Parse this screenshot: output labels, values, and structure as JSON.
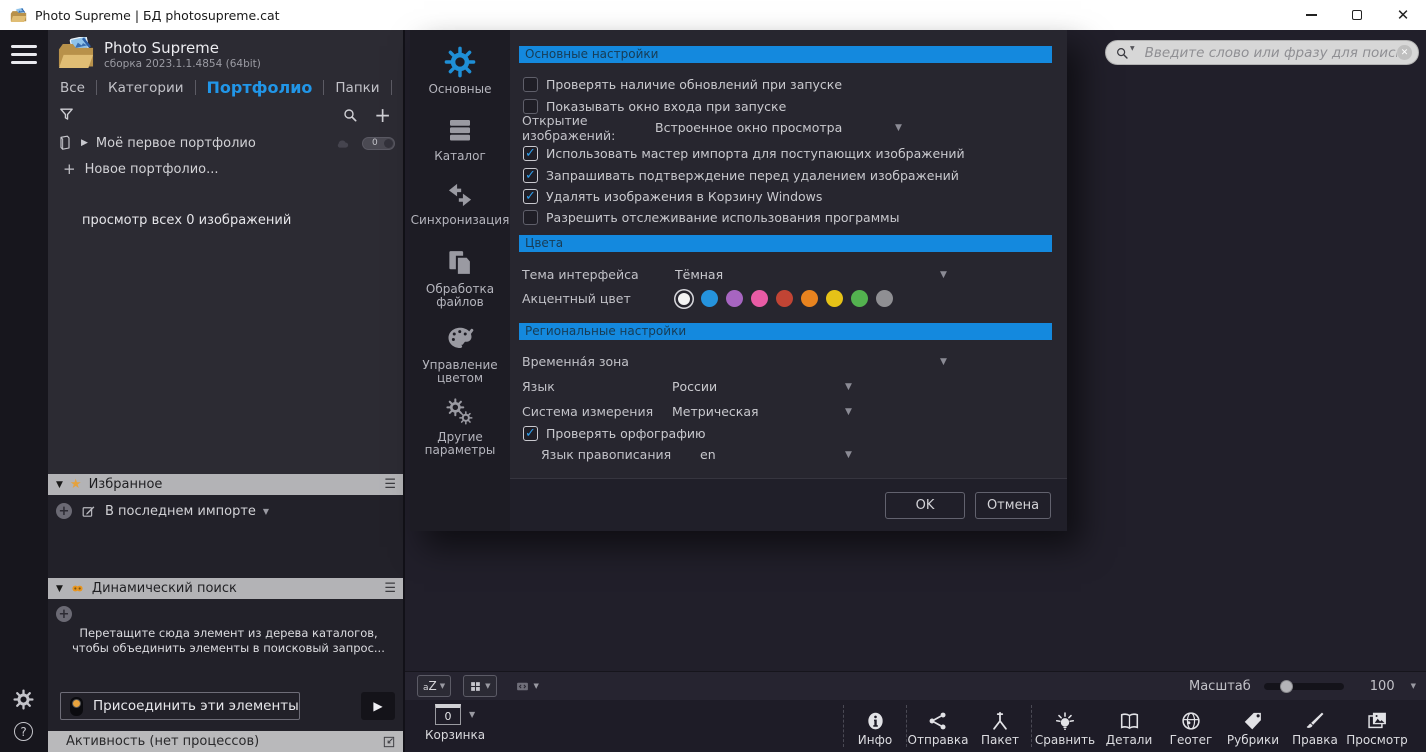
{
  "window": {
    "title": "Photo Supreme | БД photosupreme.cat"
  },
  "app": {
    "name": "Photo Supreme",
    "build": "сборка 2023.1.1.4854 (64bit)"
  },
  "nav_tabs": {
    "all": "Все",
    "categories": "Категории",
    "portfolio": "Портфолио",
    "folders": "Папки"
  },
  "portfolio_panel": {
    "first_item": "Моё первое портфолио",
    "first_item_count": "0",
    "new_portfolio": "Новое портфолио...",
    "view_all": "просмотр всех 0 изображений"
  },
  "favorites_panel": {
    "title": "Избранное",
    "last_import": "В последнем импорте"
  },
  "dynamic_search_panel": {
    "title": "Динамический поиск",
    "hint": "Перетащите сюда элемент из дерева каталогов, чтобы объединить элементы в поисковый запрос...",
    "join_button": "Присоединить эти элементы"
  },
  "activity_bar": {
    "label": "Активность (нет процессов)"
  },
  "search": {
    "placeholder": "Введите слово или фразу для поиска"
  },
  "settings": {
    "sidebar": [
      {
        "label": "Основные"
      },
      {
        "label": "Каталог"
      },
      {
        "label": "Синхронизация"
      },
      {
        "label": "Обработка файлов"
      },
      {
        "label": "Управление цветом"
      },
      {
        "label": "Другие параметры"
      }
    ],
    "general": {
      "title": "Основные настройки",
      "check_updates": "Проверять наличие обновлений при запуске",
      "show_login": "Показывать окно входа при запуске",
      "open_images_label": "Открытие изображений:",
      "open_images_value": "Встроенное окно просмотра",
      "import_wizard": "Использовать мастер импорта для поступающих изображений",
      "confirm_delete": "Запрашивать подтверждение перед удалением изображений",
      "recycle_bin": "Удалять изображения в Корзину Windows",
      "usage_tracking": "Разрешить отслеживание использования программы",
      "checks": {
        "check_updates": false,
        "show_login": false,
        "import_wizard": true,
        "confirm_delete": true,
        "recycle_bin": true,
        "usage_tracking": false
      }
    },
    "colors": {
      "title": "Цвета",
      "theme_label": "Тема интерфейса",
      "theme_value": "Тёмная",
      "accent_label": "Акцентный цвет",
      "swatches": [
        "#f4f4f4",
        "#2593dd",
        "#a765c1",
        "#e95ba5",
        "#c14434",
        "#e8831f",
        "#e6c217",
        "#53b24f",
        "#8f8f93"
      ],
      "selected_swatch": 0
    },
    "regional": {
      "title": "Региональные настройки",
      "timezone_label": "Временна́я зона",
      "language_label": "Язык",
      "language_value": "России",
      "measure_label": "Система измерения",
      "measure_value": "Метрическая",
      "spellcheck": "Проверять орфографию",
      "spellcheck_checked": true,
      "spell_lang_label": "Язык правописания",
      "spell_lang_value": "en"
    },
    "ok": "OK",
    "cancel": "Отмена"
  },
  "bottom": {
    "sort": "aZ",
    "zoom_label": "Масштаб",
    "zoom_value": "100",
    "basket_label": "Корзинка",
    "basket_count": "0"
  },
  "toolbar": [
    {
      "label": "Инфо"
    },
    {
      "label": "Отправка"
    },
    {
      "label": "Пакет"
    },
    {
      "label": "Сравнить"
    },
    {
      "label": "Детали"
    },
    {
      "label": "Геотег"
    },
    {
      "label": "Рубрики"
    },
    {
      "label": "Правка"
    },
    {
      "label": "Просмотр"
    }
  ]
}
